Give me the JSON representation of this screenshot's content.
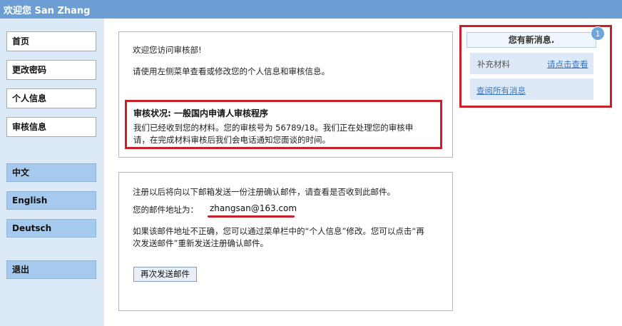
{
  "header": {
    "welcome": "欢迎您 San Zhang"
  },
  "sidebar": {
    "nav": [
      "首页",
      "更改密码",
      "个人信息",
      "审核信息"
    ],
    "languages": [
      "中文",
      "English",
      "Deutsch"
    ],
    "logout": "退出"
  },
  "intro": {
    "line1": "欢迎您访问审核部!",
    "line2": "请使用左侧菜单查看或修改您的个人信息和审核信息。"
  },
  "status": {
    "title": "审核状况: 一般国内申请人审核程序",
    "line1": "我们已经收到您的材料。您的审核号为 56789/18。我们正在处理您的审核申",
    "line2": "请，在完成材料审核后我们会电话通知您面谈的时间。"
  },
  "email": {
    "info": "注册以后将向以下邮箱发送一份注册确认邮件，请查看是否收到此邮件。",
    "address_label": "您的邮件地址为：",
    "address": "zhangsan@163.com",
    "note_line1": "如果该邮件地址不正确，您可以通过菜单栏中的“个人信息”修改。您可以点击“再",
    "note_line2": "次发送邮件”重新发送注册确认邮件。",
    "resend_label": "再次发送邮件"
  },
  "messages": {
    "header": "您有新消息.",
    "badge_count": "1",
    "item_label": "补充材料",
    "item_link": "请点击查看",
    "view_all": "查阅所有消息"
  },
  "colors": {
    "topbar": "#6c9ed3",
    "sidebar": "#dce9f7",
    "lang_button": "#a6c9ee",
    "highlight_red": "#c8202b",
    "link": "#3a78c4"
  }
}
